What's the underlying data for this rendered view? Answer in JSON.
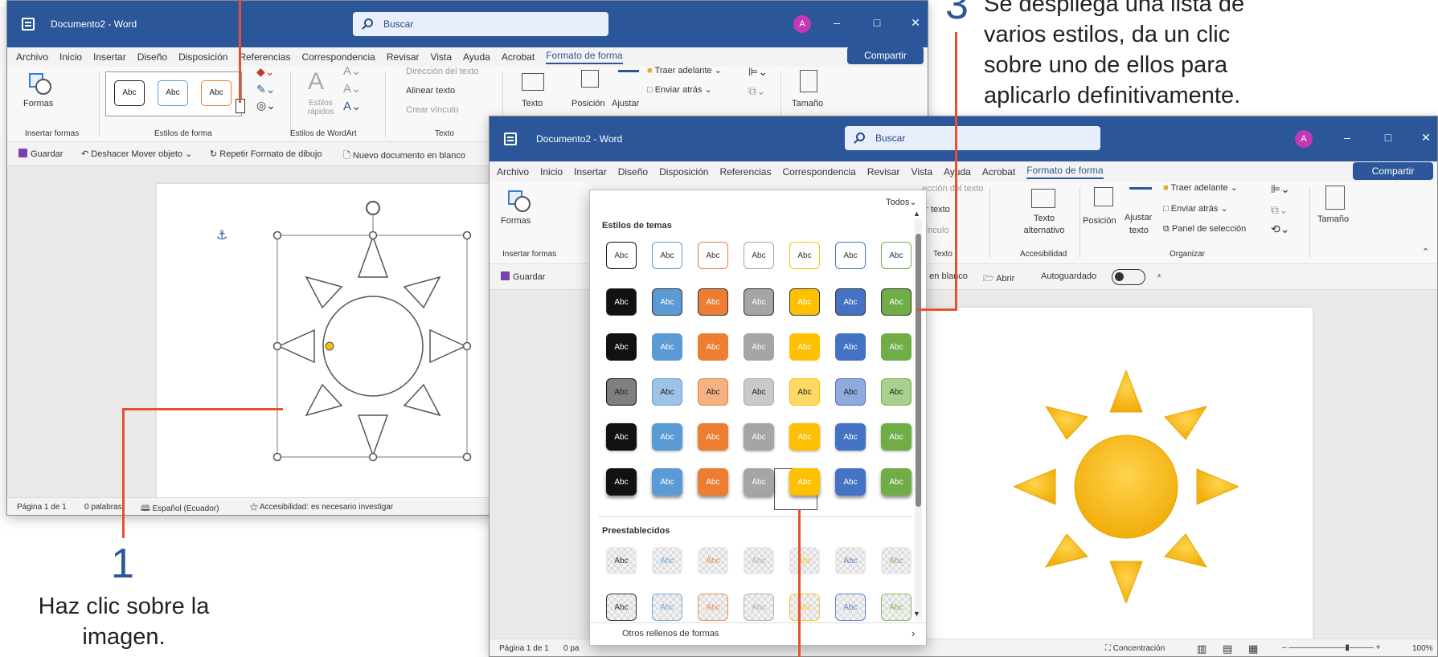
{
  "window1": {
    "title": "Documento2 - Word",
    "search": "Buscar",
    "avatar": "A",
    "controls": {
      "minimize": "–",
      "maximize": "□",
      "close": "✕"
    },
    "menu": [
      "Archivo",
      "Inicio",
      "Insertar",
      "Diseño",
      "Disposición",
      "Referencias",
      "Correspondencia",
      "Revisar",
      "Vista",
      "Ayuda",
      "Acrobat",
      "Formato de forma"
    ],
    "share": "Compartir",
    "ribbon": {
      "formas": "Formas",
      "insertar_formas": "Insertar formas",
      "estilos_forma": "Estilos de forma",
      "estilos_wordart": "Estilos de WordArt",
      "texto": "Texto",
      "estilos_rapidos": "Estilos rápidos",
      "direccion": "Dirección del texto",
      "alinear": "Alinear texto",
      "crear_vinculo": "Crear vínculo",
      "texto_alt": "Texto alternativo",
      "posicion": "Posición",
      "ajustar": "Ajustar",
      "traer": "Traer adelante",
      "enviar": "Enviar atrás",
      "tamano": "Tamaño",
      "abc": "Abc"
    },
    "qat": {
      "guardar": "Guardar",
      "deshacer": "Deshacer Mover objeto",
      "repetir": "Repetir Formato de dibujo",
      "nuevo": "Nuevo documento en blanco"
    },
    "status": {
      "pagina": "Página 1 de 1",
      "palabras": "0 palabras",
      "idioma": "Español (Ecuador)",
      "accesibilidad": "Accesibilidad: es necesario investigar"
    }
  },
  "window2": {
    "title": "Documento2 - Word",
    "search": "Buscar",
    "avatar": "A",
    "menu": [
      "Archivo",
      "Inicio",
      "Insertar",
      "Diseño",
      "Disposición",
      "Referencias",
      "Correspondencia",
      "Revisar",
      "Vista",
      "Ayuda",
      "Acrobat",
      "Formato de forma"
    ],
    "share": "Compartir",
    "ribbon": {
      "formas": "Formas",
      "insertar_formas": "Insertar formas",
      "direccion": "ección del texto",
      "alinear": "ear texto",
      "vinculo": "r vínculo",
      "texto": "Texto",
      "texto_alt": "Texto alternativo",
      "accesibilidad": "Accesibilidad",
      "posicion": "Posición",
      "ajustar": "Ajustar",
      "ajustar2": "texto",
      "traer": "Traer adelante",
      "enviar": "Enviar atrás",
      "panel": "Panel de selección",
      "organizar": "Organizar",
      "tamano": "Tamaño"
    },
    "qat": {
      "guardar": "Guardar",
      "nuevo": "o en blanco",
      "abrir": "Abrir",
      "autoguardado": "Autoguardado"
    },
    "status": {
      "pagina": "Página 1 de 1",
      "pa": "0 pa",
      "concentracion": "Concentración",
      "zoom": "100%"
    }
  },
  "gallery": {
    "filter": "Todos",
    "section1": "Estilos de temas",
    "section2": "Preestablecidos",
    "abc": "Abc",
    "footer": "Otros rellenos de formas",
    "colors": [
      "#111111",
      "#5b9bd5",
      "#ed7d31",
      "#a5a5a5",
      "#ffc000",
      "#4472c4",
      "#70ad47"
    ],
    "pale": [
      "#7f7f7f",
      "#9dc3e6",
      "#f4b183",
      "#c9c9c9",
      "#ffd966",
      "#8faadc",
      "#a9d18e"
    ]
  },
  "annotations": {
    "step1_num": "1",
    "step1_text": "Haz clic sobre la imagen.",
    "step3_num": "3",
    "step3_text": "Se despliega una lista de varios estilos, da un clic sobre uno de ellos para aplicarlo definitivamente."
  }
}
